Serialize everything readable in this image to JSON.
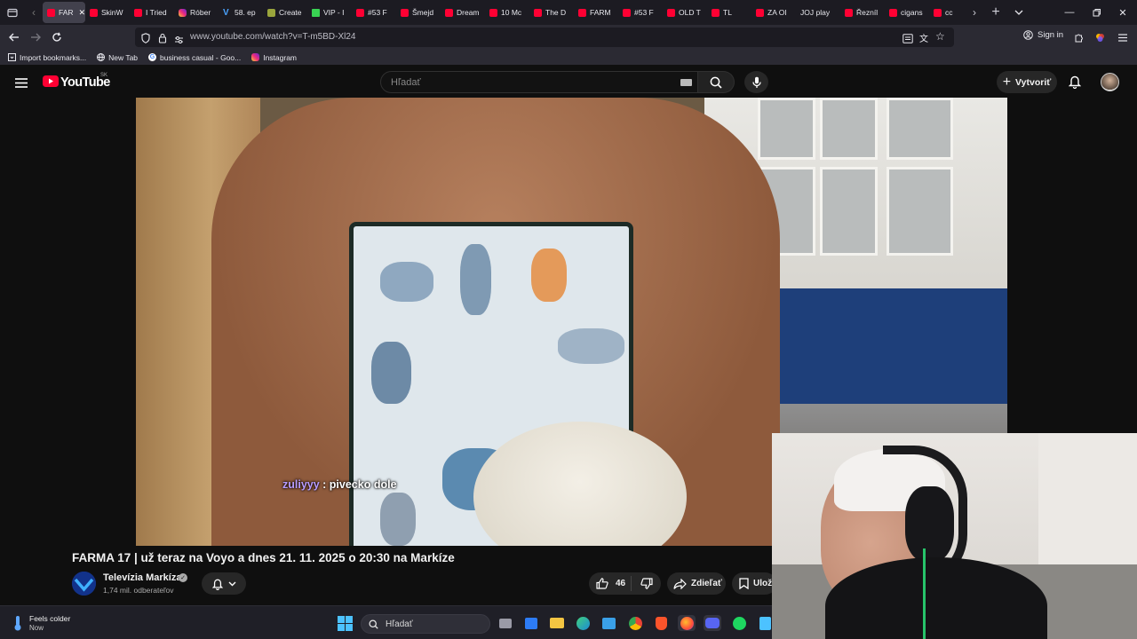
{
  "browser": {
    "tabs": [
      {
        "label": "FAR",
        "icon": "youtube",
        "active": true
      },
      {
        "label": "SkinW",
        "icon": "youtube"
      },
      {
        "label": "I Tried",
        "icon": "youtube"
      },
      {
        "label": "Róber",
        "icon": "instagram"
      },
      {
        "label": "58. ep",
        "icon": "v"
      },
      {
        "label": "Create",
        "icon": "c"
      },
      {
        "label": "VIP - I",
        "icon": "k"
      },
      {
        "label": "#53 F",
        "icon": "youtube"
      },
      {
        "label": "Šmejd",
        "icon": "youtube"
      },
      {
        "label": "Dream",
        "icon": "youtube"
      },
      {
        "label": "10 Mc",
        "icon": "youtube"
      },
      {
        "label": "The D",
        "icon": "youtube"
      },
      {
        "label": "FARM",
        "icon": "youtube"
      },
      {
        "label": "#53 F",
        "icon": "youtube"
      },
      {
        "label": "OLD T",
        "icon": "youtube"
      },
      {
        "label": "TL",
        "icon": "youtube"
      },
      {
        "label": "ZA OI",
        "icon": "youtube"
      },
      {
        "label": "JOJ play",
        "icon": "none"
      },
      {
        "label": "Řezníl",
        "icon": "youtube"
      },
      {
        "label": "cigans",
        "icon": "youtube"
      },
      {
        "label": "cc",
        "icon": "youtube"
      }
    ],
    "url": "www.youtube.com/watch?v=T-m5BD-Xl24",
    "sign_in": "Sign in",
    "bookmarks": [
      {
        "label": "Import bookmarks...",
        "icon": "import-icon"
      },
      {
        "label": "New Tab",
        "icon": "globe-icon"
      },
      {
        "label": "business casual - Goo...",
        "icon": "google-icon"
      },
      {
        "label": "Instagram",
        "icon": "instagram-icon"
      }
    ]
  },
  "youtube": {
    "logo": "YouTube",
    "country": "SK",
    "search_placeholder": "Hľadať",
    "create_label": "Vytvoriť"
  },
  "video": {
    "chat_user": "zuliyyy",
    "chat_message": " : pivecko dole",
    "title": "FARMA 17 | už teraz na Voyo a dnes 21. 11. 2025 o 20:30 na Markíze",
    "channel": {
      "name": "Televízia Markíza",
      "subscribers": "1,74 mil. odberateľov"
    },
    "like_count": "46",
    "share_label": "Zdieľať",
    "save_label": "Ulož"
  },
  "taskbar": {
    "weather_title": "Feels colder",
    "weather_sub": "Now",
    "search_label": "Hľadať"
  },
  "colors": {
    "yt_red": "#ff0033",
    "chat_user": "#b89cff"
  }
}
